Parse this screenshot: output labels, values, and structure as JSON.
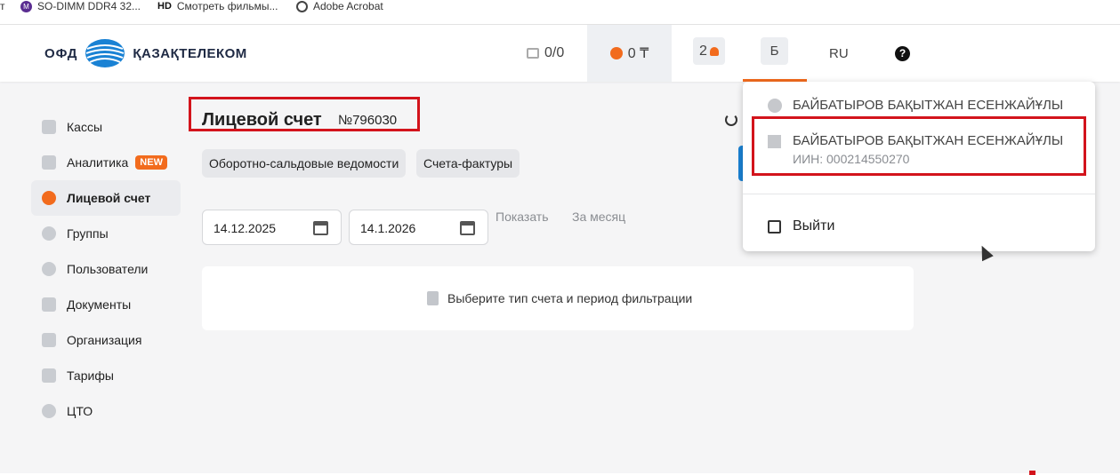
{
  "bookmarks": [
    {
      "label": "т",
      "icon": "folder-icon"
    },
    {
      "label": "SO-DIMM DDR4 32...",
      "icon": "m-circle-icon"
    },
    {
      "label": "Смотреть фильмы...",
      "icon": "hd-icon",
      "icon_text": "HD"
    },
    {
      "label": "Adobe Acrobat",
      "icon": "acrobat-icon"
    }
  ],
  "header": {
    "logo_left": "ОФД",
    "logo_right": "ҚАЗАҚТЕЛЕКОМ",
    "cash_counter": "0/0",
    "balance": "0 ₸",
    "notifications_count": "2",
    "user_initial": "Б",
    "language": "RU",
    "help_symbol": "?"
  },
  "sidebar": {
    "items": [
      {
        "label": "Кассы",
        "icon": "cash-register-icon"
      },
      {
        "label": "Аналитика",
        "icon": "chart-icon",
        "badge": "NEW"
      },
      {
        "label": "Лицевой счет",
        "icon": "coins-icon",
        "active": true
      },
      {
        "label": "Группы",
        "icon": "groups-icon"
      },
      {
        "label": "Пользователи",
        "icon": "user-icon"
      },
      {
        "label": "Документы",
        "icon": "document-icon"
      },
      {
        "label": "Организация",
        "icon": "building-icon"
      },
      {
        "label": "Тарифы",
        "icon": "tariff-icon"
      },
      {
        "label": "ЦТО",
        "icon": "wrench-icon"
      }
    ]
  },
  "main": {
    "title": "Лицевой счет",
    "account_number": "№796030",
    "chips": [
      "Оборотно-сальдовые ведомости",
      "Счета-фактуры"
    ],
    "date_from": "14.12.2025",
    "date_to": "14.1.2026",
    "show_label": "Показать",
    "month_label": "За месяц",
    "empty_message": "Выберите тип счета и период фильтрации"
  },
  "dropdown": {
    "user_name": "БАЙБАТЫРОВ БАҚЫТЖАН ЕСЕНЖАЙҰЛЫ",
    "org_name": "БАЙБАТЫРОВ БАҚЫТЖАН ЕСЕНЖАЙҰЛЫ",
    "org_iin": "ИИН: 000214550270",
    "logout_label": "Выйти"
  },
  "colors": {
    "accent": "#f26b1d",
    "highlight_border": "#d3141c",
    "brand_blue": "#1a82d4"
  }
}
